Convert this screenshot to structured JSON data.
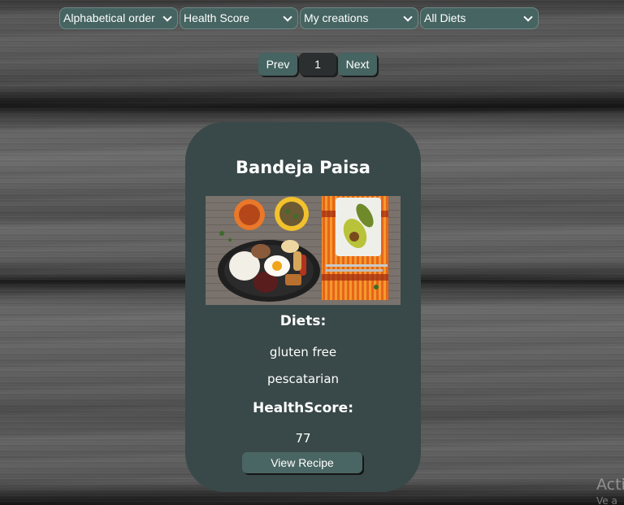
{
  "filters": {
    "sort": "Alphabetical order",
    "health": "Health Score",
    "source": "My creations",
    "diet": "All Diets"
  },
  "pagination": {
    "prev_label": "Prev",
    "current_page": "1",
    "next_label": "Next"
  },
  "card": {
    "title": "Bandeja Paisa",
    "image_description": "photo of bandeja paisa dish",
    "diets_label": "Diets:",
    "diets": [
      "gluten free",
      "pescatarian"
    ],
    "health_label": "HealthScore:",
    "health_score": "77",
    "button_label": "View Recipe"
  },
  "watermark": {
    "line1": "Acti",
    "line2": "Ve a"
  },
  "colors": {
    "control_bg": "#456462",
    "card_bg": "#394848",
    "active_page_bg": "#2c2f2f"
  }
}
